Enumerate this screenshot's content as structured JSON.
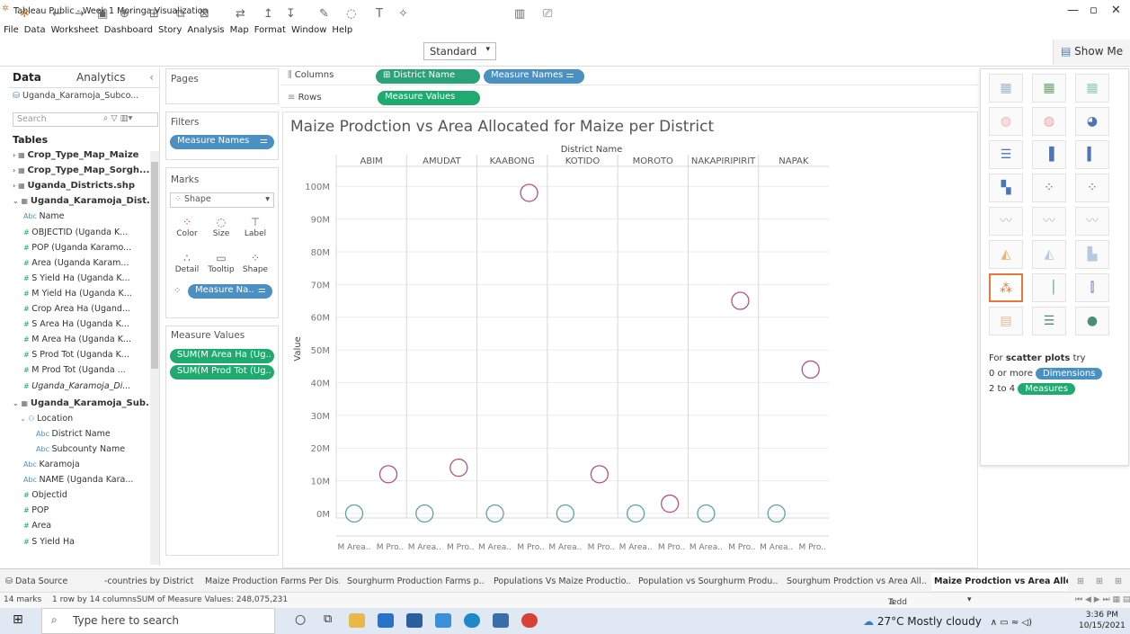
{
  "window": {
    "title": "Tableau Public - Week 1 Moringa Visualization"
  },
  "menu": [
    "File",
    "Data",
    "Worksheet",
    "Dashboard",
    "Story",
    "Analysis",
    "Map",
    "Format",
    "Window",
    "Help"
  ],
  "toolbar": {
    "fit": "Standard",
    "showme": "Show Me"
  },
  "datapane": {
    "tab_data": "Data",
    "tab_analytics": "Analytics",
    "datasource": "Uganda_Karamoja_Subco...",
    "search_placeholder": "Search",
    "tables_label": "Tables",
    "items": [
      {
        "text": "Crop_Type_Map_Maize",
        "kind": "table"
      },
      {
        "text": "Crop_Type_Map_Sorgh...",
        "kind": "table"
      },
      {
        "text": "Uganda_Districts.shp",
        "kind": "table"
      },
      {
        "text": "Uganda_Karamoja_Dist...",
        "kind": "table"
      },
      {
        "text": "Name",
        "kind": "abc"
      },
      {
        "text": "OBJECTID (Uganda K...",
        "kind": "num"
      },
      {
        "text": "POP (Uganda Karamo...",
        "kind": "num"
      },
      {
        "text": "Area (Uganda Karam...",
        "kind": "num"
      },
      {
        "text": "S Yield Ha (Uganda K...",
        "kind": "num"
      },
      {
        "text": "M Yield Ha (Uganda K...",
        "kind": "num"
      },
      {
        "text": "Crop Area Ha (Ugand...",
        "kind": "num"
      },
      {
        "text": "S Area Ha (Uganda K...",
        "kind": "num"
      },
      {
        "text": "M Area Ha (Uganda K...",
        "kind": "num"
      },
      {
        "text": "S Prod Tot (Uganda K...",
        "kind": "num"
      },
      {
        "text": "M Prod Tot (Uganda ...",
        "kind": "num"
      },
      {
        "text": "Uganda_Karamoja_Di...",
        "kind": "num"
      },
      {
        "text": "Uganda_Karamoja_Sub...",
        "kind": "table"
      },
      {
        "text": "Location",
        "kind": "folder"
      },
      {
        "text": "District Name",
        "kind": "abc"
      },
      {
        "text": "Subcounty Name",
        "kind": "abc"
      },
      {
        "text": "Karamoja",
        "kind": "abc"
      },
      {
        "text": "NAME (Uganda Kara...",
        "kind": "abc"
      },
      {
        "text": "Objectid",
        "kind": "num"
      },
      {
        "text": "POP",
        "kind": "num"
      },
      {
        "text": "Area",
        "kind": "num"
      },
      {
        "text": "S Yield Ha",
        "kind": "num"
      }
    ]
  },
  "cards": {
    "pages": "Pages",
    "filters": "Filters",
    "filter_pill": "Measure Names",
    "marks": "Marks",
    "mark_type": "Shape",
    "mark_buttons": [
      "Color",
      "Size",
      "Label",
      "Detail",
      "Tooltip",
      "Shape"
    ],
    "marks_pill": "Measure Na..",
    "measure_values": "Measure Values",
    "mv_pills": [
      "SUM(M Area Ha (Ug..",
      "SUM(M Prod Tot (Ug.."
    ]
  },
  "shelves": {
    "columns": "Columns",
    "rows": "Rows",
    "col_pills": [
      "District Name",
      "Measure Names"
    ],
    "row_pill": "Measure Values"
  },
  "chart_data": {
    "type": "scatter",
    "title": "Maize Prodction vs Area Allocated for Maize per District",
    "header": "District Name",
    "ylabel": "Value",
    "ylim": [
      0,
      105000000
    ],
    "yticks": [
      "0M",
      "10M",
      "20M",
      "30M",
      "40M",
      "50M",
      "60M",
      "70M",
      "80M",
      "90M",
      "100M"
    ],
    "categories": [
      "ABIM",
      "AMUDAT",
      "KAABONG",
      "KOTIDO",
      "MOROTO",
      "NAKAPIRIPIRIT",
      "NAPAK"
    ],
    "sub_labels": [
      "M Area..",
      "M Pro.."
    ],
    "series": [
      {
        "name": "M Area Ha",
        "color": "#5aa3a0",
        "values": [
          0,
          0,
          0,
          0,
          0,
          0,
          0
        ]
      },
      {
        "name": "M Prod Tot",
        "color": "#b1567e",
        "values": [
          12000000,
          14000000,
          98000000,
          12000000,
          3000000,
          65000000,
          44000000
        ]
      }
    ]
  },
  "showme": {
    "hint_pre": "For",
    "hint_bold": "scatter plots",
    "hint_post": "try",
    "dim_pre": "0 or more",
    "dim_pill": "Dimensions",
    "meas_pre": "2 to 4",
    "meas_pill": "Measures"
  },
  "sheets": {
    "datasource": "Data Source",
    "tabs": [
      " -countries by District",
      "Maize Production Farms Per Dis...",
      "Sourghurm Production Farms p...",
      "Populations Vs Maize Productio...",
      "Population vs Sourghurm Produ...",
      "Sourghum Prodction vs Area All...",
      "Maize Prodction vs Area Alloca..."
    ]
  },
  "status": {
    "marks": "14 marks",
    "dims": "1 row by 14 columns",
    "sum": "SUM of Measure Values: 248,075,231",
    "user": "Tedd"
  },
  "taskbar": {
    "search": "Type here to search",
    "weather": "27°C  Mostly cloudy",
    "time": "3:36 PM",
    "date": "10/15/2021"
  }
}
